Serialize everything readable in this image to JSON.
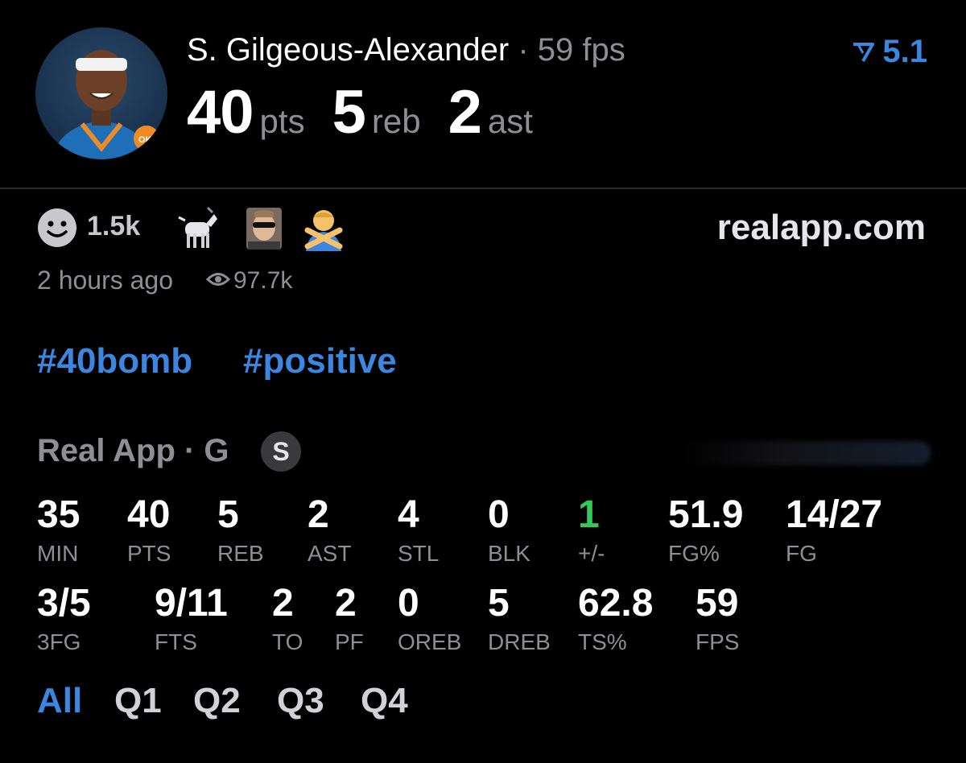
{
  "header": {
    "player_name": "S. Gilgeous-Alexander",
    "separator": "·",
    "fps_text": "59 fps",
    "points": "40",
    "points_unit": "pts",
    "rebounds": "5",
    "rebounds_unit": "reb",
    "assists": "2",
    "assists_unit": "ast",
    "rating": "5.1",
    "avatar_icon": "player-avatar"
  },
  "reactions": {
    "count": "1.5k",
    "icons": [
      "smiley-icon",
      "goat-icon",
      "sunglasses-player-icon",
      "crossed-arms-icon"
    ],
    "site": "realapp.com",
    "time_ago": "2 hours ago",
    "views": "97.7k"
  },
  "hashtags": [
    "#40bomb",
    "#positive"
  ],
  "source": {
    "label": "Real App · G",
    "badge": "S"
  },
  "stats_row1": [
    {
      "value": "35",
      "label": "MIN"
    },
    {
      "value": "40",
      "label": "PTS"
    },
    {
      "value": "5",
      "label": "REB"
    },
    {
      "value": "2",
      "label": "AST"
    },
    {
      "value": "4",
      "label": "STL"
    },
    {
      "value": "0",
      "label": "BLK"
    },
    {
      "value": "1",
      "label": "+/-"
    },
    {
      "value": "51.9",
      "label": "FG%"
    },
    {
      "value": "14/27",
      "label": "FG"
    }
  ],
  "stats_row2": [
    {
      "value": "3/5",
      "label": "3FG"
    },
    {
      "value": "9/11",
      "label": "FTS"
    },
    {
      "value": "2",
      "label": "TO"
    },
    {
      "value": "2",
      "label": "PF"
    },
    {
      "value": "0",
      "label": "OREB"
    },
    {
      "value": "5",
      "label": "DREB"
    },
    {
      "value": "62.8",
      "label": "TS%"
    },
    {
      "value": "59",
      "label": "FPS"
    }
  ],
  "quarters": {
    "tabs": [
      "All",
      "Q1",
      "Q2",
      "Q3",
      "Q4"
    ],
    "active": "All"
  },
  "colors": {
    "accent": "#3a86e0",
    "positive": "#34c759",
    "muted": "#8e8e93"
  }
}
